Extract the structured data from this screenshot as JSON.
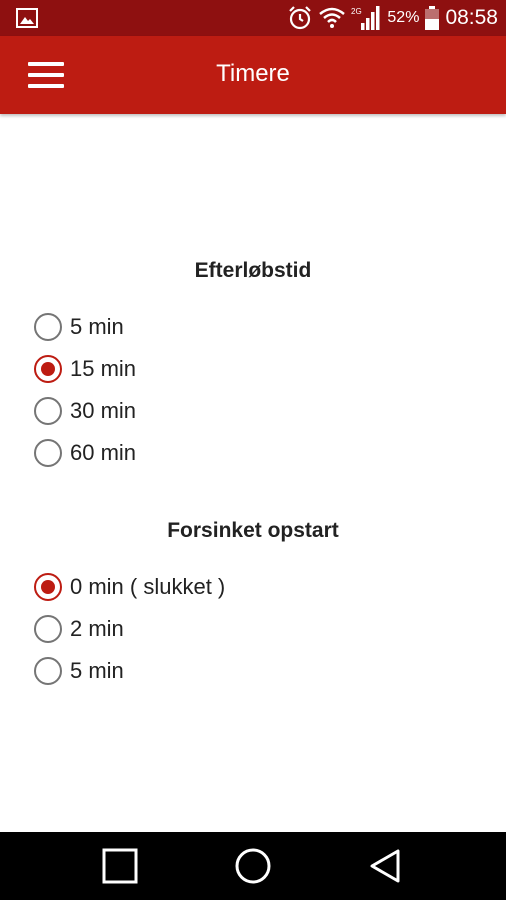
{
  "status_bar": {
    "battery_percent": "52%",
    "time": "08:58",
    "network_badge": "2G",
    "icons": [
      "gallery-icon",
      "alarm-icon",
      "wifi-icon",
      "signal-icon",
      "battery-icon"
    ]
  },
  "app_bar": {
    "title": "Timere",
    "menu_icon": "hamburger-menu-icon",
    "color": "#bd1c12"
  },
  "sections": [
    {
      "title": "Efterløbstid",
      "options": [
        "5 min",
        "15 min",
        "30 min",
        "60 min"
      ],
      "selected": "15 min"
    },
    {
      "title": "Forsinket opstart",
      "options": [
        "0 min ( slukket )",
        "2 min",
        "5 min"
      ],
      "selected": "0 min ( slukket )"
    }
  ],
  "nav_bar": {
    "buttons": [
      "recents-square-icon",
      "home-circle-icon",
      "back-triangle-icon"
    ]
  },
  "colors": {
    "status_bar": "#8e1010",
    "accent": "#bd1c12",
    "radio_unchecked": "#757575"
  }
}
